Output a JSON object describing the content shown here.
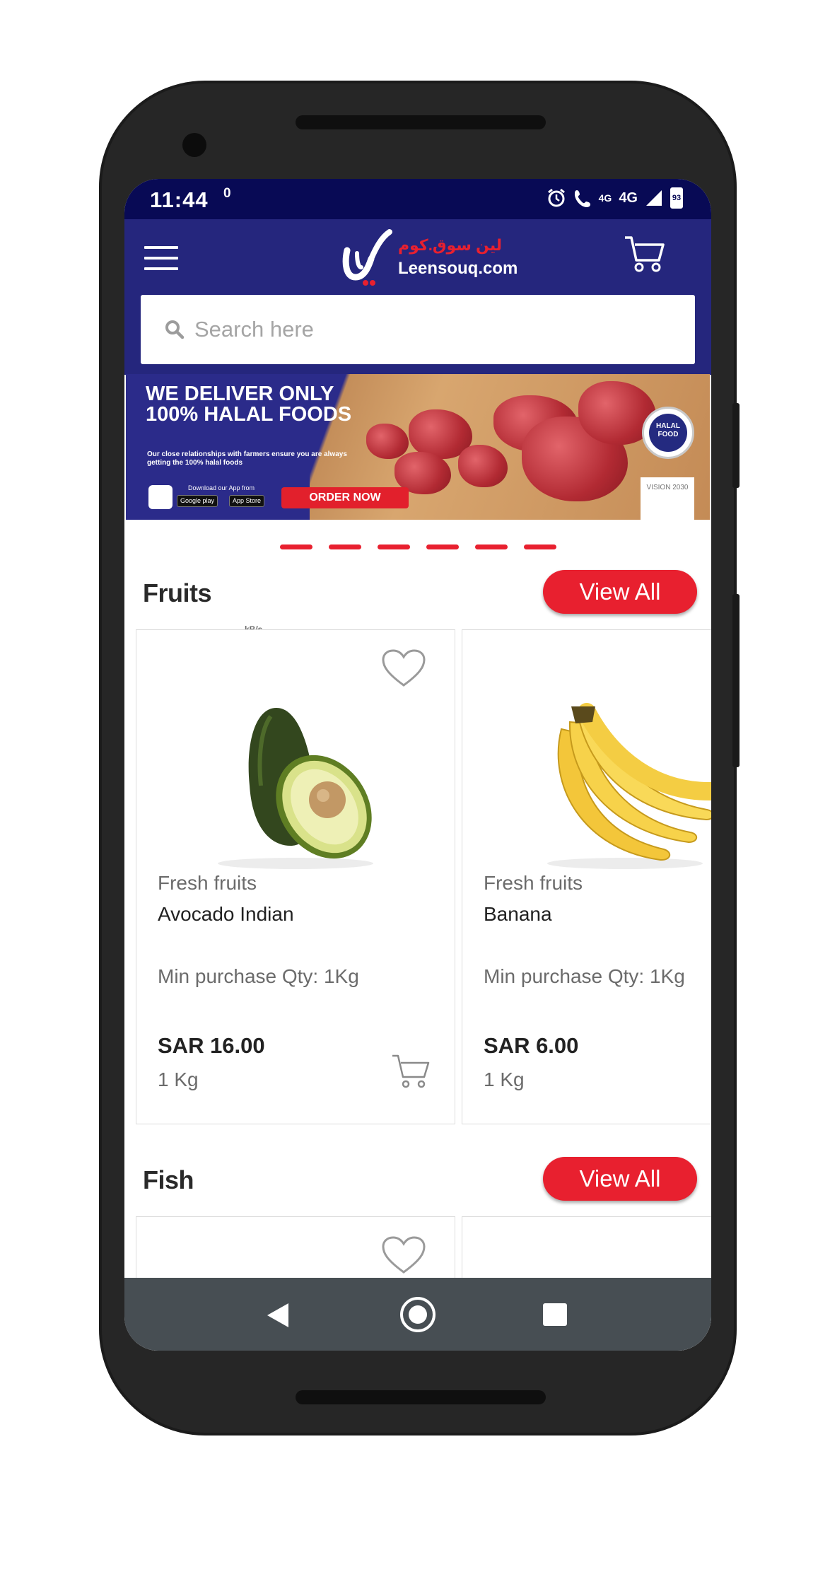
{
  "status_bar": {
    "time": "11:44",
    "speed_value": "0",
    "speed_unit": "kB/s",
    "network": "4G",
    "network_small": "4G",
    "battery": "93"
  },
  "header": {
    "logo_arabic": "لين سوق.كوم",
    "logo_english": "Leensouq.com",
    "search_placeholder": "Search here"
  },
  "banner": {
    "headline": "WE DELIVER ONLY 100% HALAL FOODS",
    "subtext": "Our close relationships with farmers ensure you are always getting the 100% halal foods",
    "download_text": "Download our App from",
    "google_play": "Google play",
    "app_store": "App Store",
    "order_button": "ORDER NOW",
    "halal_badge": "HALAL FOOD",
    "vision": "VISION 2030",
    "slide_count": 6
  },
  "sections": [
    {
      "title": "Fruits",
      "view_all": "View All",
      "products": [
        {
          "category": "Fresh fruits",
          "name": "Avocado Indian",
          "min_qty": "Min purchase Qty: 1Kg",
          "price": "SAR 16.00",
          "unit": "1 Kg",
          "image": "avocado"
        },
        {
          "category": "Fresh fruits",
          "name": "Banana",
          "min_qty": "Min purchase Qty: 1Kg",
          "price": "SAR 6.00",
          "unit": "1 Kg",
          "image": "banana"
        }
      ]
    },
    {
      "title": "Fish",
      "view_all": "View All"
    }
  ],
  "nav": {
    "back": "back-icon",
    "home": "home-icon",
    "recents": "recents-icon"
  },
  "colors": {
    "primary": "#25267d",
    "status": "#080a55",
    "accent": "#e8202f",
    "navbar": "#474e53"
  }
}
